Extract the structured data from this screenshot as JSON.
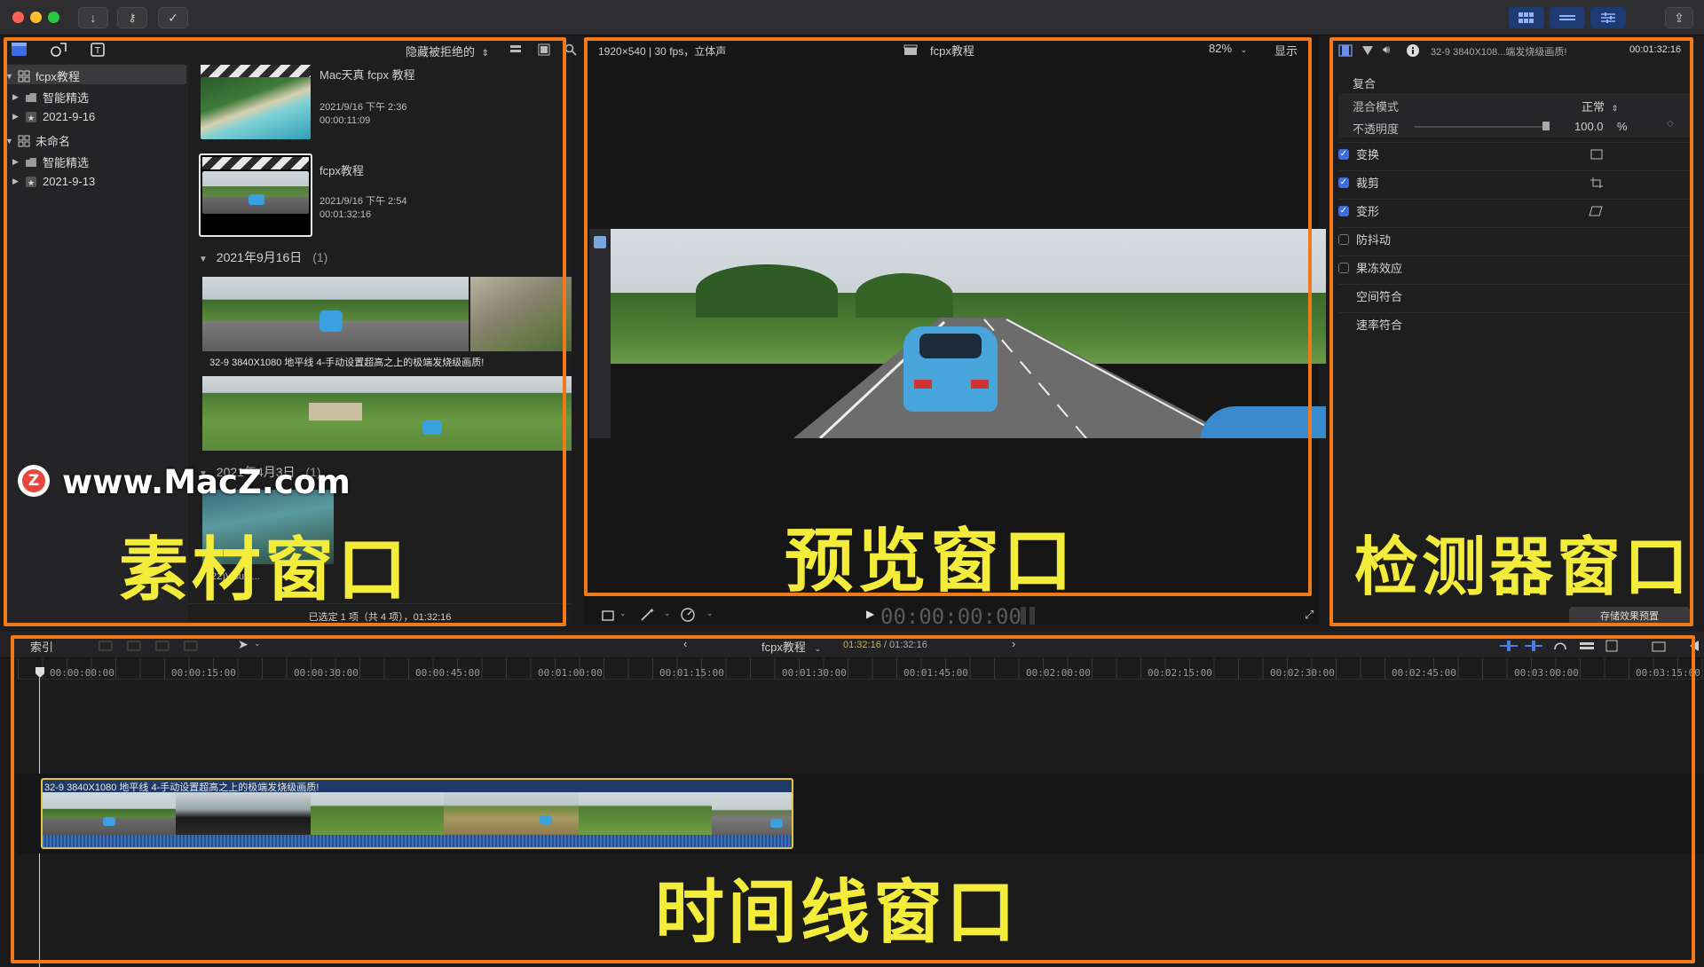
{
  "titlebar": {
    "buttons": [
      "import-icon",
      "key-icon",
      "checkmark-circle-icon"
    ],
    "right_buttons": [
      "grid-view-icon",
      "timeline-view-icon",
      "inspector-view-icon",
      "share-icon"
    ]
  },
  "browser": {
    "filter_label": "隐藏被拒绝的",
    "library": [
      {
        "label": "fcpx教程",
        "type": "library"
      },
      {
        "label": "智能精选",
        "type": "folder"
      },
      {
        "label": "2021-9-16",
        "type": "event"
      },
      {
        "label": "未命名",
        "type": "library"
      },
      {
        "label": "智能精选",
        "type": "folder"
      },
      {
        "label": "2021-9-13",
        "type": "event"
      }
    ],
    "projects": [
      {
        "title": "Mac天真 fcpx 教程",
        "date": "2021/9/16 下午 2:36",
        "duration": "00:00:11:09"
      },
      {
        "title": "fcpx教程",
        "date": "2021/9/16 下午 2:54",
        "duration": "00:01:32:16"
      }
    ],
    "group1": {
      "date": "2021年9月16日",
      "count": "(1)"
    },
    "clip_caption": "32-9 3840X1080 地平线 4-手动设置超高之上的极端发烧级画质!",
    "group2": {
      "date": "2021年4月3日",
      "count": "(1)"
    },
    "clip2_caption": "22)Visual...",
    "status": "已选定 1 项（共 4 项），01:32:16"
  },
  "viewer": {
    "format": "1920×540 | 30 fps，立体声",
    "title": "fcpx教程",
    "zoom": "82%",
    "display_menu": "显示",
    "timecode": "00:00:00:00"
  },
  "inspector": {
    "clip_name": "32-9 3840X108...端发烧级画质!",
    "duration": "00:01:32:16",
    "section": "复合",
    "blend_mode_label": "混合模式",
    "blend_mode_value": "正常",
    "opacity_label": "不透明度",
    "opacity_value": "100.0",
    "opacity_unit": "%",
    "rows": [
      {
        "label": "变换",
        "checked": true,
        "icon": "transform-icon"
      },
      {
        "label": "裁剪",
        "checked": true,
        "icon": "crop-icon"
      },
      {
        "label": "变形",
        "checked": true,
        "icon": "distort-icon"
      },
      {
        "label": "防抖动",
        "checked": false
      },
      {
        "label": "果冻效应",
        "checked": false
      },
      {
        "label": "空间符合",
        "checked": null
      },
      {
        "label": "速率符合",
        "checked": null
      }
    ],
    "save_preset": "存储效果预置"
  },
  "timeline": {
    "index_label": "索引",
    "project_name": "fcpx教程",
    "timecode_current": "01:32:16",
    "timecode_total": "01:32:16",
    "ruler": [
      "00:00:00:00",
      "00:00:15:00",
      "00:00:30:00",
      "00:00:45:00",
      "00:01:00:00",
      "00:01:15:00",
      "00:01:30:00",
      "00:01:45:00",
      "00:02:00:00",
      "00:02:15:00",
      "00:02:30:00",
      "00:02:45:00",
      "00:03:00:00",
      "00:03:15:00"
    ],
    "clip_title": "32-9 3840X1080 地平线 4-手动设置超高之上的极端发烧级画质!"
  },
  "annotations": {
    "browser": "素材窗口",
    "viewer": "预览窗口",
    "inspector": "检测器窗口",
    "timeline": "时间线窗口"
  },
  "watermark": "www.MacZ.com",
  "colors": {
    "annotation_frame": "#f07a1a",
    "annotation_text": "#f4ec3a",
    "accent_blue": "#3c6de0"
  }
}
